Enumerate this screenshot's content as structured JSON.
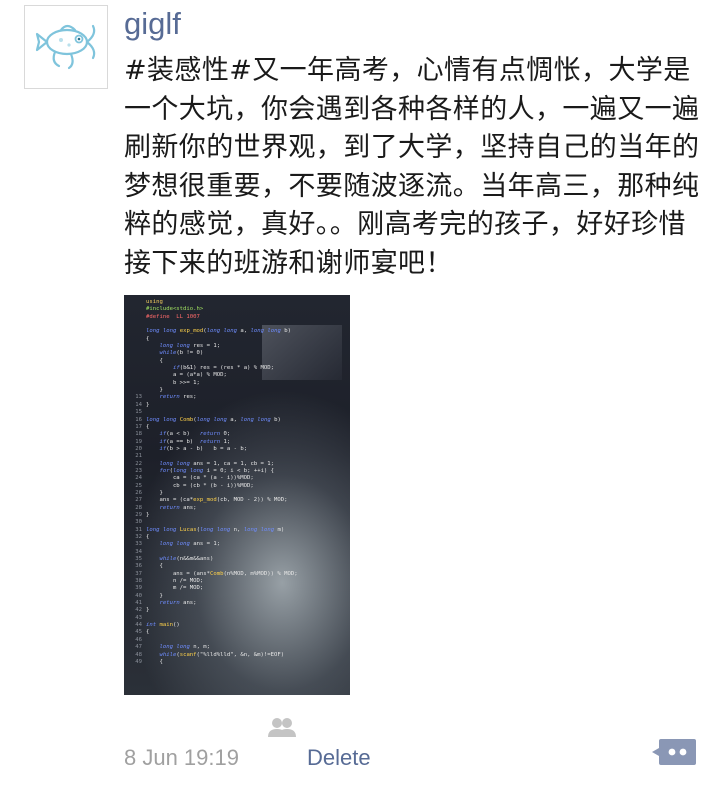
{
  "post": {
    "username": "giglf",
    "text": "#装感性#又一年高考，心情有点惆怅，大学是一个大坑，你会遇到各种各样的人，一遍又一遍刷新你的世界观，到了大学，坚持自己的当年的梦想很重要，不要随波逐流。当年高三，那种纯粹的感觉，真好。。刚高考完的孩子，好好珍惜接下来的班游和谢师宴吧！",
    "timestamp": "8 Jun  19:19",
    "delete_label": "Delete"
  },
  "photo_code": [
    {
      "n": "",
      "t": "using"
    },
    {
      "n": "",
      "t": "#include<stdio.h>"
    },
    {
      "n": "",
      "t": "#define  LL 1007"
    },
    {
      "n": "",
      "t": ""
    },
    {
      "n": "",
      "t": "long long exp_mod(long long a, long long b)"
    },
    {
      "n": "",
      "t": "{"
    },
    {
      "n": "",
      "t": "    long long res = 1;"
    },
    {
      "n": "",
      "t": "    while(b != 0)"
    },
    {
      "n": "",
      "t": "    {"
    },
    {
      "n": "",
      "t": "        if(b&1) res = (res * a) % MOD;"
    },
    {
      "n": "",
      "t": "        a = (a*a) % MOD;"
    },
    {
      "n": "",
      "t": "        b >>= 1;"
    },
    {
      "n": "",
      "t": "    }"
    },
    {
      "n": "13",
      "t": "    return res;"
    },
    {
      "n": "14",
      "t": "}"
    },
    {
      "n": "15",
      "t": ""
    },
    {
      "n": "16",
      "t": "long long Comb(long long a, long long b)"
    },
    {
      "n": "17",
      "t": "{"
    },
    {
      "n": "18",
      "t": "    if(a < b)   return 0;"
    },
    {
      "n": "19",
      "t": "    if(a == b)  return 1;"
    },
    {
      "n": "20",
      "t": "    if(b > a - b)   b = a - b;"
    },
    {
      "n": "21",
      "t": ""
    },
    {
      "n": "22",
      "t": "    long long ans = 1, ca = 1, cb = 1;"
    },
    {
      "n": "23",
      "t": "    for(long long i = 0; i < b; ++i) {"
    },
    {
      "n": "24",
      "t": "        ca = (ca * (a - i))%MOD;"
    },
    {
      "n": "25",
      "t": "        cb = (cb * (b - i))%MOD;"
    },
    {
      "n": "26",
      "t": "    }"
    },
    {
      "n": "27",
      "t": "    ans = (ca*exp_mod(cb, MOD - 2)) % MOD;"
    },
    {
      "n": "28",
      "t": "    return ans;"
    },
    {
      "n": "29",
      "t": "}"
    },
    {
      "n": "30",
      "t": ""
    },
    {
      "n": "31",
      "t": "long long Lucas(long long n, long long m)"
    },
    {
      "n": "32",
      "t": "{"
    },
    {
      "n": "33",
      "t": "    long long ans = 1;"
    },
    {
      "n": "34",
      "t": ""
    },
    {
      "n": "35",
      "t": "    while(n&&m&&ans)"
    },
    {
      "n": "36",
      "t": "    {"
    },
    {
      "n": "37",
      "t": "        ans = (ans*Comb(n%MOD, m%MOD)) % MOD;"
    },
    {
      "n": "38",
      "t": "        n /= MOD;"
    },
    {
      "n": "39",
      "t": "        m /= MOD;"
    },
    {
      "n": "40",
      "t": "    }"
    },
    {
      "n": "41",
      "t": "    return ans;"
    },
    {
      "n": "42",
      "t": "}"
    },
    {
      "n": "43",
      "t": ""
    },
    {
      "n": "44",
      "t": "int main()"
    },
    {
      "n": "45",
      "t": "{"
    },
    {
      "n": "46",
      "t": ""
    },
    {
      "n": "47",
      "t": "    long long n, m;"
    },
    {
      "n": "48",
      "t": "    while(scanf(\"%lld%lld\", &n, &m)!=EOF)"
    },
    {
      "n": "49",
      "t": "    {"
    }
  ],
  "colors": {
    "link": "#576b95",
    "text": "#1a1a1a",
    "muted": "#a0a0a0",
    "comment_button": "#8a97b5"
  },
  "icons": {
    "avatar": "fish-logo",
    "likes": "people-icon",
    "comment": "comment-dots-icon"
  }
}
